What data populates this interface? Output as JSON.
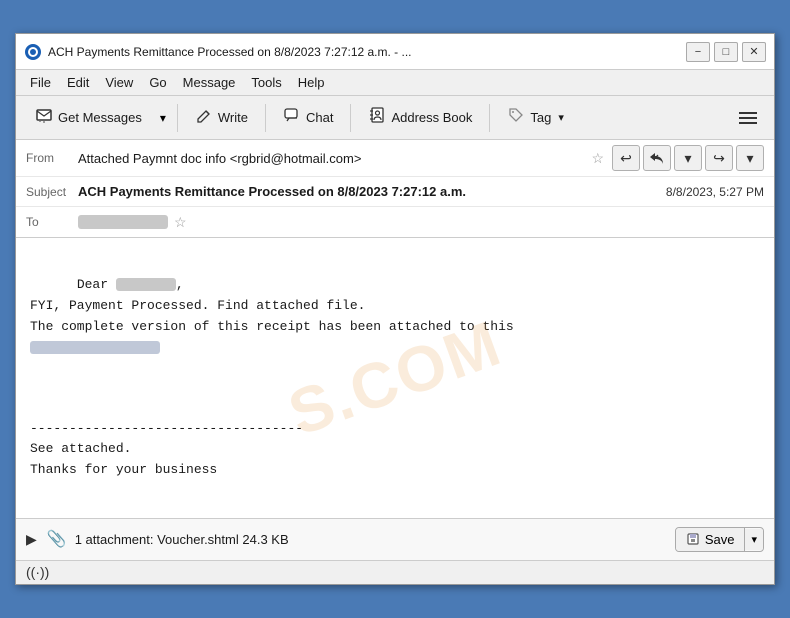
{
  "window": {
    "title": "ACH Payments Remittance Processed on 8/8/2023 7:27:12 a.m. - ...",
    "icon": "🌐"
  },
  "menubar": {
    "items": [
      "File",
      "Edit",
      "View",
      "Go",
      "Message",
      "Tools",
      "Help"
    ]
  },
  "toolbar": {
    "get_messages_label": "Get Messages",
    "write_label": "Write",
    "chat_label": "Chat",
    "address_book_label": "Address Book",
    "tag_label": "Tag",
    "hamburger_label": "Menu"
  },
  "email": {
    "from_label": "From",
    "from_value": "Attached Paymnt doc info <rgbrid@hotmail.com>",
    "subject_label": "Subject",
    "subject_value": "ACH Payments Remittance Processed on 8/8/2023 7:27:12 a.m.",
    "date_value": "8/8/2023, 5:27 PM",
    "to_label": "To",
    "body_line1": "Dear ",
    "body_line2": "FYI, Payment Processed. Find attached file.",
    "body_line3": "The complete version of this receipt has been attached to this",
    "body_separator": "-----------------------------------",
    "body_line4": "See attached.",
    "body_line5": "Thanks for your business"
  },
  "attachment": {
    "expand_icon": "▶",
    "clip_icon": "📎",
    "text": "1 attachment: Voucher.shtml",
    "size": "24.3 KB",
    "save_label": "Save",
    "dropdown_icon": "▾"
  },
  "status_bar": {
    "wifi_icon": "((·))"
  },
  "colors": {
    "accent": "#1a5fb4",
    "background": "#4a7ab5"
  }
}
